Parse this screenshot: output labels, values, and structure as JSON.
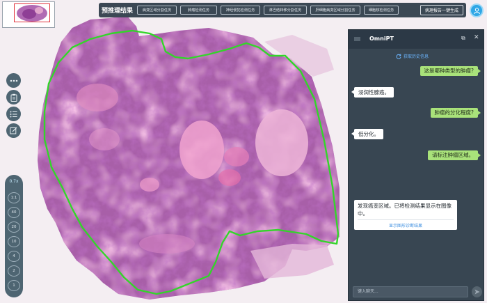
{
  "topbar": {
    "title": "预推理结果",
    "tasks": [
      "病变区域分割任务",
      "肿瘤检测任务",
      "神经侵犯检测任务",
      "淋巴结转移分割任务",
      "肝细胞病变区域分割任务",
      "细胞核检测任务"
    ],
    "report_button": "病理报告一键生成"
  },
  "zoom": {
    "current": "0.7x",
    "levels": [
      "1:1",
      "40",
      "20",
      "10",
      "4",
      "2",
      "1"
    ]
  },
  "chat": {
    "title": "OmniPT",
    "history_link": "获取历史信息",
    "messages": [
      {
        "role": "user",
        "text": "这是哪种类型的肿瘤?"
      },
      {
        "role": "bot",
        "text": "浸润性腺癌。"
      },
      {
        "role": "user",
        "text": "肿瘤的分化程度?"
      },
      {
        "role": "bot",
        "text": "低分化。"
      },
      {
        "role": "user",
        "text": "请标注肿瘤区域。"
      }
    ],
    "final_message": {
      "text": "发现癌变区域。已将检测结果显示在图像中。",
      "link": "显示图形诊断结果"
    },
    "input_placeholder": "键入聊天..."
  },
  "colors": {
    "tumor_outline": "#33d52a",
    "thumbnail_box": "#e0303a",
    "panel_bg": "#384652",
    "user_bubble": "#a9e27a",
    "link": "#3d8fe0"
  }
}
